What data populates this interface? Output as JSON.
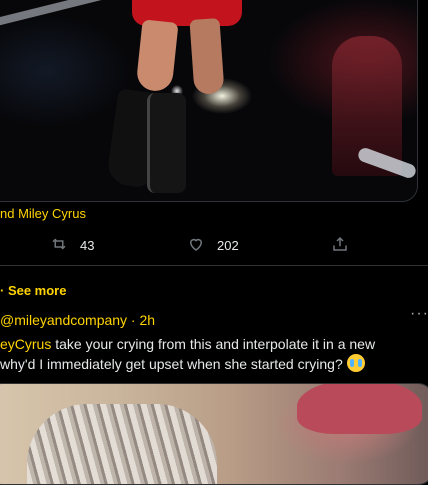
{
  "tweet1": {
    "caption": "nd Miley Cyrus",
    "actions": {
      "retweets": "43",
      "likes": "202"
    }
  },
  "see_more": "· See more",
  "tweet2": {
    "header": "@mileyandcompany · 2h",
    "body_line1_mention": "eyCyrus",
    "body_line1_rest": " take your crying from this and interpolate it in a new",
    "body_line2": "why'd I immediately get upset when she started crying? ",
    "emoji": "loudly-crying-face-emoji",
    "more_label": "···"
  },
  "colors": {
    "accent": "#ffd400",
    "background": "#000000",
    "text": "#e7e9ea",
    "divider": "#2f3336"
  }
}
